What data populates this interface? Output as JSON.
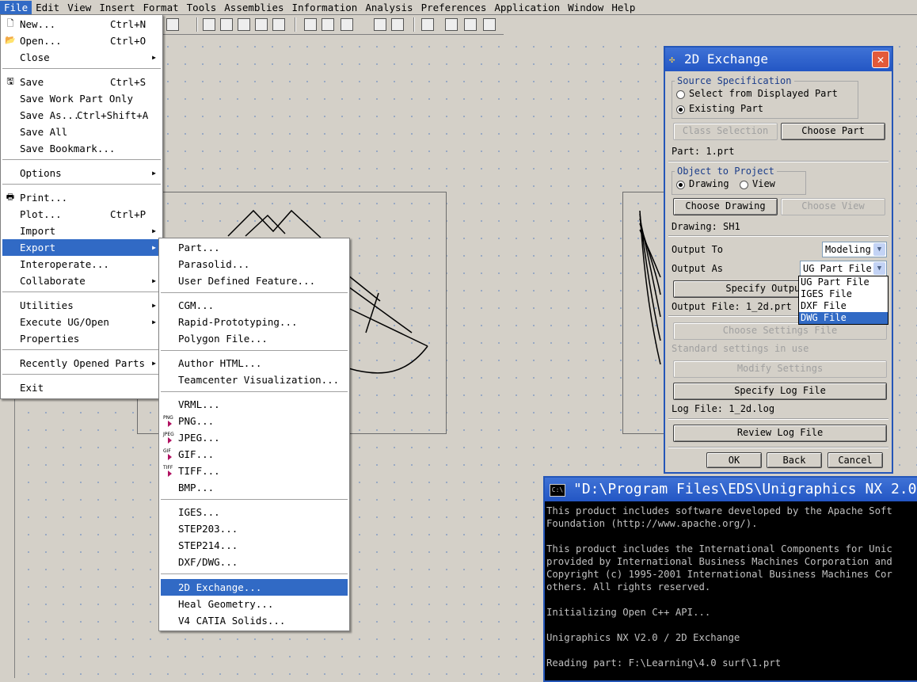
{
  "menubar": [
    "File",
    "Edit",
    "View",
    "Insert",
    "Format",
    "Tools",
    "Assemblies",
    "Information",
    "Analysis",
    "Preferences",
    "Application",
    "Window",
    "Help"
  ],
  "file_menu": {
    "items": [
      {
        "label": "New...",
        "shortcut": "Ctrl+N",
        "icon": "new-document-icon"
      },
      {
        "label": "Open...",
        "shortcut": "Ctrl+O",
        "icon": "open-folder-icon"
      },
      {
        "label": "Close",
        "submenu": true
      },
      {
        "label": "Save",
        "shortcut": "Ctrl+S",
        "icon": "save-disk-icon"
      },
      {
        "label": "Save Work Part Only"
      },
      {
        "label": "Save As...",
        "shortcut": "Ctrl+Shift+A"
      },
      {
        "label": "Save All"
      },
      {
        "label": "Save Bookmark..."
      },
      {
        "label": "Options",
        "submenu": true
      },
      {
        "label": "Print...",
        "icon": "printer-icon"
      },
      {
        "label": "Plot...",
        "shortcut": "Ctrl+P"
      },
      {
        "label": "Import",
        "submenu": true
      },
      {
        "label": "Export",
        "submenu": true,
        "selected": true
      },
      {
        "label": "Interoperate..."
      },
      {
        "label": "Collaborate",
        "submenu": true
      },
      {
        "label": "Utilities",
        "submenu": true
      },
      {
        "label": "Execute UG/Open",
        "submenu": true
      },
      {
        "label": "Properties"
      },
      {
        "label": "Recently Opened Parts",
        "submenu": true
      },
      {
        "label": "Exit"
      }
    ]
  },
  "export_menu": {
    "items": [
      {
        "label": "Part..."
      },
      {
        "label": "Parasolid..."
      },
      {
        "label": "User Defined Feature..."
      },
      {
        "label": "CGM..."
      },
      {
        "label": "Rapid-Prototyping..."
      },
      {
        "label": "Polygon File..."
      },
      {
        "label": "Author HTML..."
      },
      {
        "label": "Teamcenter Visualization..."
      },
      {
        "label": "VRML..."
      },
      {
        "label": "PNG...",
        "icon_text": "PNG"
      },
      {
        "label": "JPEG...",
        "icon_text": "JPEG"
      },
      {
        "label": "GIF...",
        "icon_text": "GIF"
      },
      {
        "label": "TIFF...",
        "icon_text": "TIFF"
      },
      {
        "label": "BMP..."
      },
      {
        "label": "IGES..."
      },
      {
        "label": "STEP203..."
      },
      {
        "label": "STEP214..."
      },
      {
        "label": "DXF/DWG..."
      },
      {
        "label": "2D Exchange...",
        "selected": true
      },
      {
        "label": "Heal Geometry..."
      },
      {
        "label": "V4 CATIA Solids..."
      }
    ]
  },
  "dialog": {
    "title": "2D Exchange",
    "close": "✕",
    "source_group": "Source Specification",
    "radio_displayed": "Select from Displayed Part",
    "radio_existing": "Existing Part",
    "class_selection": "Class Selection",
    "choose_part": "Choose Part",
    "part": "Part: 1.prt",
    "object_group": "Object to Project",
    "radio_drawing": "Drawing",
    "radio_view": "View",
    "choose_drawing": "Choose Drawing",
    "choose_view": "Choose View",
    "drawing": "Drawing: SH1",
    "output_to_label": "Output To",
    "output_to_value": "Modeling",
    "output_as_label": "Output As",
    "output_as_value": "UG Part File",
    "output_as_options": [
      "UG Part File",
      "IGES File",
      "DXF File",
      "DWG File"
    ],
    "output_as_highlight": "DWG File",
    "specify_output": "Specify Output File",
    "output_file": "Output File: 1_2d.prt",
    "choose_settings": "Choose Settings File",
    "standard_settings": "Standard settings in use",
    "modify_settings": "Modify Settings",
    "specify_log": "Specify Log File",
    "log_file": "Log File: 1_2d.log",
    "review_log": "Review Log File",
    "ok": "OK",
    "back": "Back",
    "cancel": "Cancel"
  },
  "console": {
    "title": "\"D:\\Program Files\\EDS\\Unigraphics NX 2.0",
    "icon_text": "C:\\",
    "lines": [
      "This product includes software developed by the Apache Soft",
      "Foundation (http://www.apache.org/).",
      "",
      "This product includes the International Components for Unic",
      "provided by International Business Machines Corporation and",
      "Copyright (c) 1995-2001 International Business Machines Cor",
      "others. All rights reserved.",
      "",
      "Initializing Open C++ API...",
      "",
      "Unigraphics NX V2.0 / 2D Exchange",
      "",
      "Reading part: F:\\Learning\\4.0 surf\\1.prt"
    ]
  }
}
